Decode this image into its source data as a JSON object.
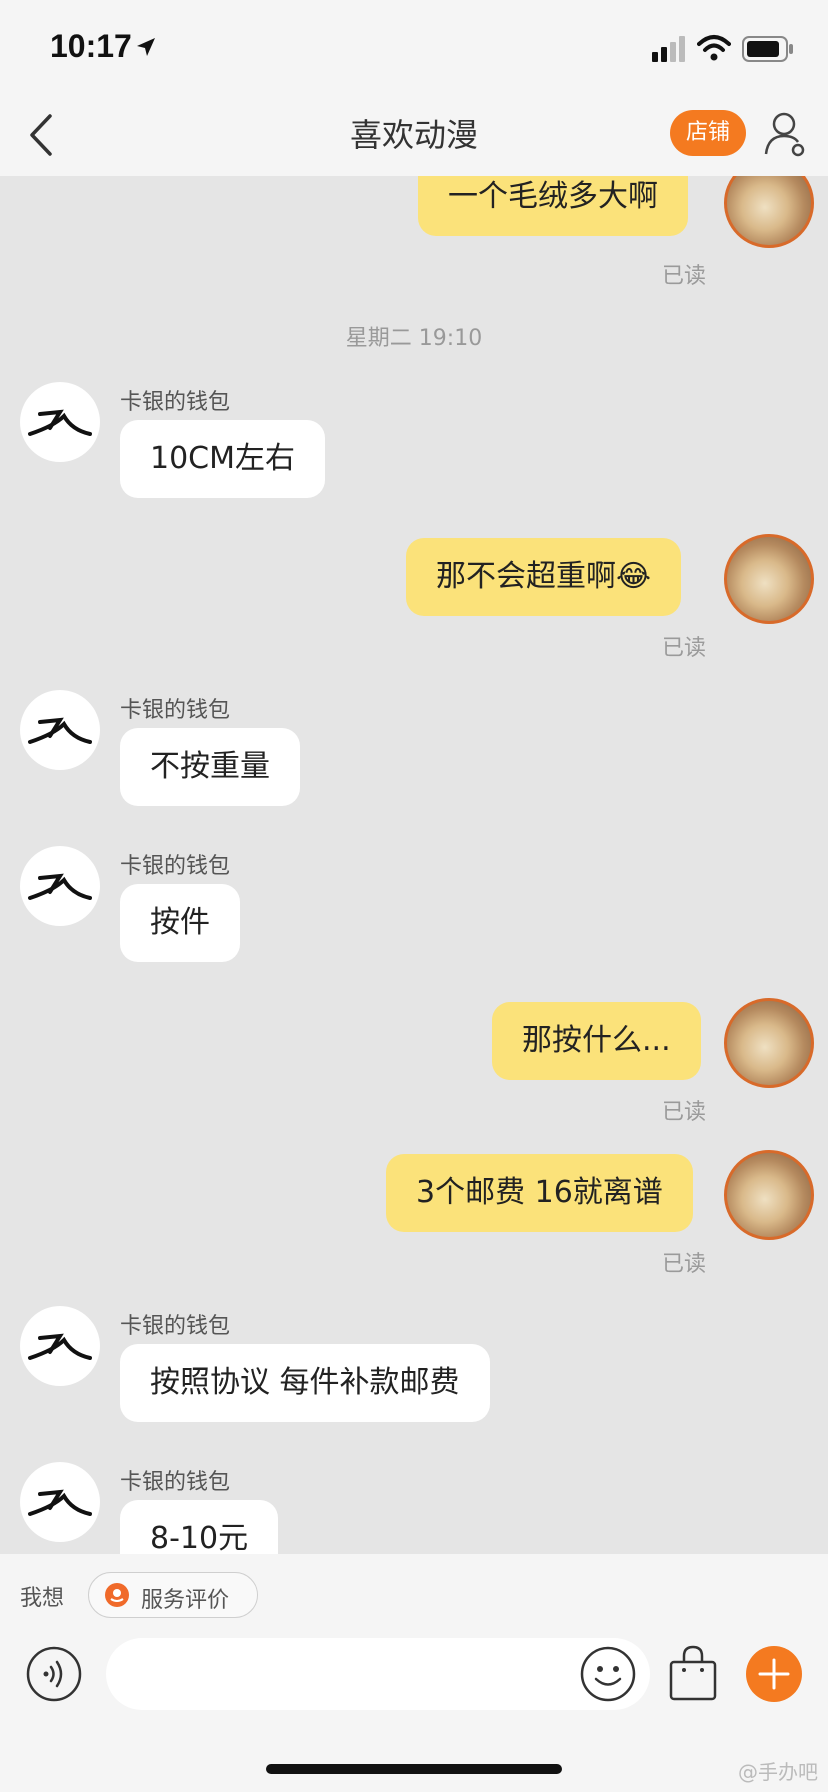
{
  "status_bar": {
    "time": "10:17"
  },
  "nav": {
    "title": "喜欢动漫",
    "shop_label": "店铺"
  },
  "messages": {
    "m1": {
      "text": "一个毛绒多大啊",
      "read": "已读"
    },
    "timestamp": "星期二 19:10",
    "m2": {
      "sender": "卡银的钱包",
      "text": "10CM左右"
    },
    "m3": {
      "text": "那不会超重啊😂",
      "read": "已读"
    },
    "m4": {
      "sender": "卡银的钱包",
      "text": "不按重量"
    },
    "m5": {
      "sender": "卡银的钱包",
      "text": "按件"
    },
    "m6": {
      "text": "那按什么...",
      "read": "已读"
    },
    "m7": {
      "text": "3个邮费 16就离谱",
      "read": "已读"
    },
    "m8": {
      "sender": "卡银的钱包",
      "text": "按照协议 每件补款邮费"
    },
    "m9": {
      "sender": "卡银的钱包",
      "text": "8-10元"
    }
  },
  "quick_bar": {
    "prefix": "我想",
    "chip_label": "服务评价"
  },
  "input_bar": {
    "placeholder": ""
  },
  "watermark": "@手办吧",
  "colors": {
    "accent": "#f47a20",
    "my_bubble": "#fbe27a",
    "their_bubble": "#ffffff"
  }
}
